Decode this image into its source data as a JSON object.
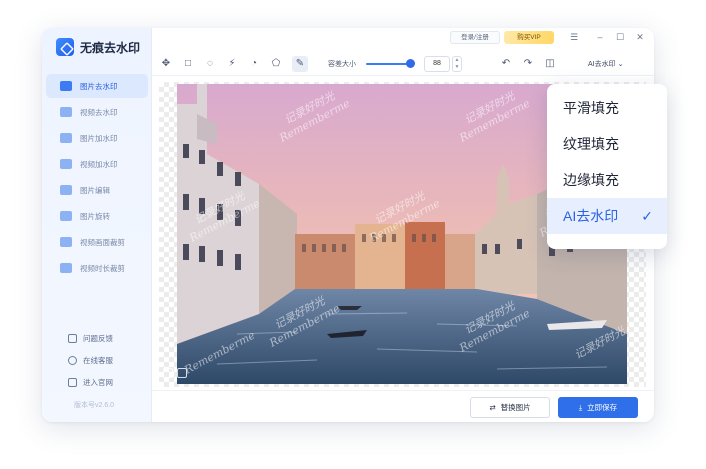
{
  "app": {
    "title": "无痕去水印",
    "version": "版本号v2.6.0"
  },
  "sidebar": {
    "items": [
      {
        "label": "图片去水印",
        "active": true
      },
      {
        "label": "视频去水印",
        "active": false
      },
      {
        "label": "图片加水印",
        "active": false
      },
      {
        "label": "视频加水印",
        "active": false
      },
      {
        "label": "图片编辑",
        "active": false
      },
      {
        "label": "图片旋转",
        "active": false
      },
      {
        "label": "视频画面裁剪",
        "active": false
      },
      {
        "label": "视频时长裁剪",
        "active": false
      }
    ],
    "bottom_links": [
      "问题反馈",
      "在线客服",
      "进入官网"
    ]
  },
  "titlebar": {
    "login": "登录/注册",
    "vip": "购买VIP"
  },
  "toolbar": {
    "brush_label": "容差大小",
    "brush_value": "88",
    "brush_level_percent": 88,
    "ai_label": "AI去水印"
  },
  "footer": {
    "replace": "替换图片",
    "save": "立即保存"
  },
  "dropdown": {
    "options": [
      "平滑填充",
      "纹理填充",
      "边缘填充",
      "AI去水印"
    ],
    "selected": "AI去水印"
  },
  "watermark": {
    "cn": "记录好时光",
    "en": "Rememberme"
  },
  "colors": {
    "accent": "#2f6fea",
    "sidebar_active": "#dce8fd",
    "vip": "#ffd767"
  }
}
